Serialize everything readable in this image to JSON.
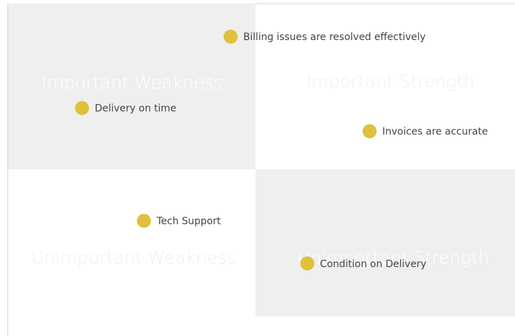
{
  "chart_data": {
    "type": "scatter",
    "title": "",
    "xlabel": "",
    "ylabel": "",
    "xlim": [
      -1,
      1
    ],
    "ylim": [
      -1,
      1
    ],
    "grid": false,
    "quadrants": [
      {
        "key": "tl",
        "label": "Important Weakness",
        "fill": "#efefef",
        "text_color": "#ffffff"
      },
      {
        "key": "tr",
        "label": "Important Strength",
        "fill": "#ffffff",
        "text_color": "#efefef"
      },
      {
        "key": "bl",
        "label": "Unimportant Weakness",
        "fill": "#ffffff",
        "text_color": "#efefef"
      },
      {
        "key": "br",
        "label": "Unimportant Strength",
        "fill": "#efefef",
        "text_color": "#ffffff"
      }
    ],
    "points": [
      {
        "label": "Billing issues are resolved effectively",
        "x": -0.1,
        "y": 0.8
      },
      {
        "label": "Delivery on time",
        "x": -0.7,
        "y": 0.37
      },
      {
        "label": "Invoices are accurate",
        "x": 0.44,
        "y": 0.23
      },
      {
        "label": "Tech Support",
        "x": -0.45,
        "y": -0.35
      },
      {
        "label": "Condition on Delivery",
        "x": 0.2,
        "y": -0.64
      }
    ],
    "colors": {
      "marker": "#e1c03c",
      "label": "#444444",
      "axis": "#cccccc"
    }
  }
}
